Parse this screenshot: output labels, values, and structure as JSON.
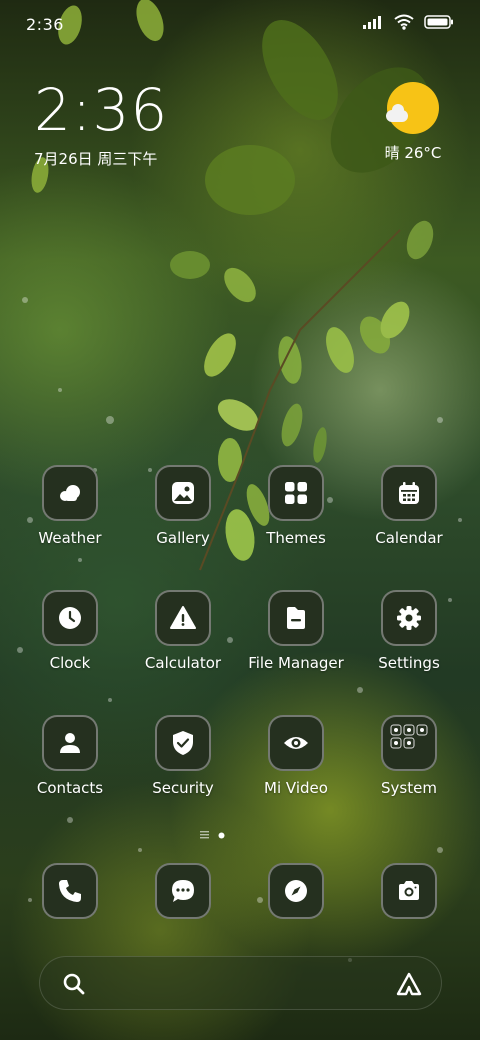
{
  "status_bar": {
    "time": "2:36",
    "icons": [
      "signal-icon",
      "wifi-icon",
      "battery-icon"
    ]
  },
  "clock_widget": {
    "time": "2:36",
    "date": "7月26日 周三下午"
  },
  "weather_widget": {
    "icon": "sun-cloud-icon",
    "text": "晴 26°C"
  },
  "apps": [
    {
      "label": "Weather",
      "icon": "weather-icon"
    },
    {
      "label": "Gallery",
      "icon": "gallery-icon"
    },
    {
      "label": "Themes",
      "icon": "themes-icon"
    },
    {
      "label": "Calendar",
      "icon": "calendar-icon"
    },
    {
      "label": "Clock",
      "icon": "clock-icon"
    },
    {
      "label": "Calculator",
      "icon": "calculator-icon"
    },
    {
      "label": "File Manager",
      "icon": "file-manager-icon"
    },
    {
      "label": "Settings",
      "icon": "gear-icon"
    },
    {
      "label": "Contacts",
      "icon": "contacts-icon"
    },
    {
      "label": "Security",
      "icon": "security-shield-icon"
    },
    {
      "label": "Mi Video",
      "icon": "mi-video-icon"
    },
    {
      "label": "System",
      "icon": "system-folder-icon"
    }
  ],
  "dock": [
    {
      "icon": "phone-icon"
    },
    {
      "icon": "messages-icon"
    },
    {
      "icon": "browser-compass-icon"
    },
    {
      "icon": "camera-icon"
    }
  ],
  "search_bar": {
    "icon": "search-icon",
    "assistant_icon": "assistant-icon"
  },
  "colors": {
    "icon_bg": "#25301f",
    "sun": "#f7c316"
  }
}
